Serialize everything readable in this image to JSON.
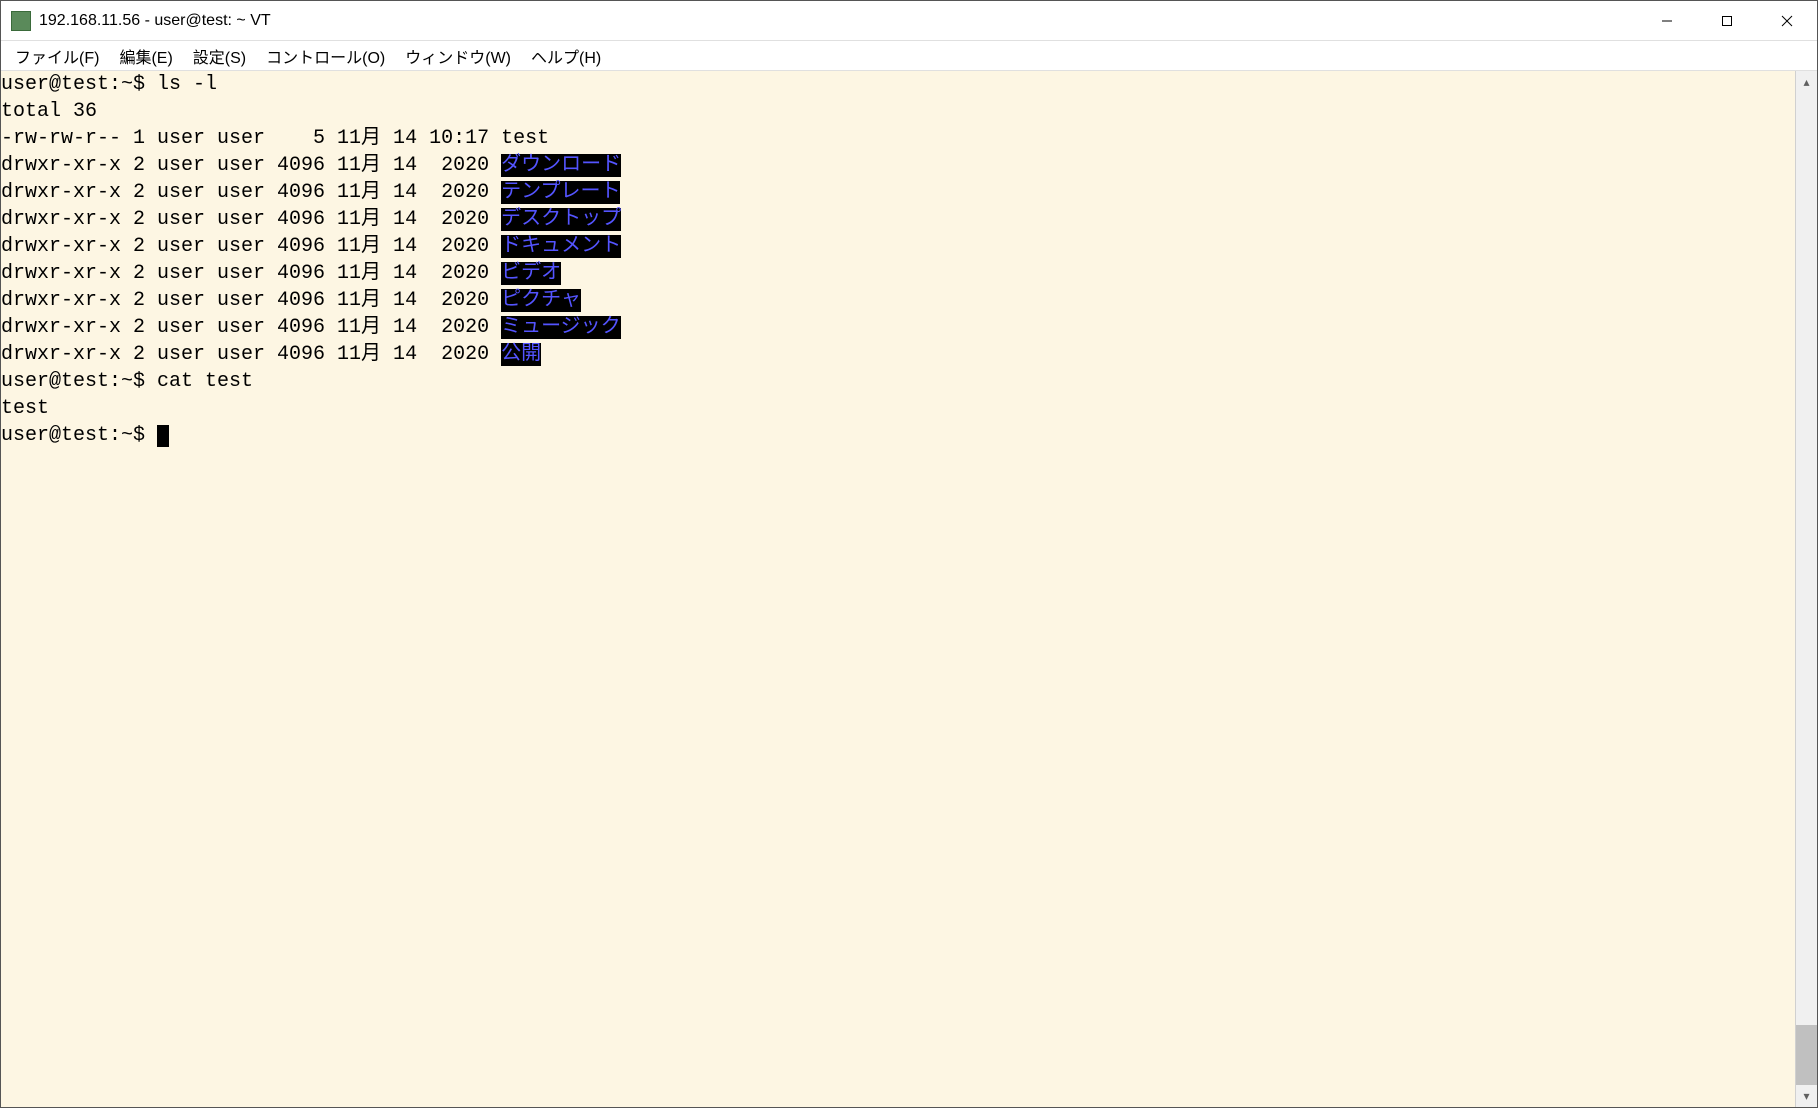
{
  "window": {
    "title": "192.168.11.56 - user@test: ~ VT"
  },
  "menubar": {
    "file": "ファイル(F)",
    "edit": "編集(E)",
    "setup": "設定(S)",
    "control": "コントロール(O)",
    "window": "ウィンドウ(W)",
    "help": "ヘルプ(H)"
  },
  "terminal": {
    "prompt1": "user@test:~$ ",
    "cmd1": "ls -l",
    "total_line": "total 36",
    "rows": [
      {
        "pre": "-rw-rw-r-- 1 user user    5 11月 14 10:17 ",
        "name": "test",
        "is_dir": false
      },
      {
        "pre": "drwxr-xr-x 2 user user 4096 11月 14  2020 ",
        "name": "ダウンロード",
        "is_dir": true
      },
      {
        "pre": "drwxr-xr-x 2 user user 4096 11月 14  2020 ",
        "name": "テンプレート",
        "is_dir": true
      },
      {
        "pre": "drwxr-xr-x 2 user user 4096 11月 14  2020 ",
        "name": "デスクトップ",
        "is_dir": true
      },
      {
        "pre": "drwxr-xr-x 2 user user 4096 11月 14  2020 ",
        "name": "ドキュメント",
        "is_dir": true
      },
      {
        "pre": "drwxr-xr-x 2 user user 4096 11月 14  2020 ",
        "name": "ビデオ",
        "is_dir": true
      },
      {
        "pre": "drwxr-xr-x 2 user user 4096 11月 14  2020 ",
        "name": "ピクチャ",
        "is_dir": true
      },
      {
        "pre": "drwxr-xr-x 2 user user 4096 11月 14  2020 ",
        "name": "ミュージック",
        "is_dir": true
      },
      {
        "pre": "drwxr-xr-x 2 user user 4096 11月 14  2020 ",
        "name": "公開",
        "is_dir": true
      }
    ],
    "prompt2": "user@test:~$ ",
    "cmd2": "cat test",
    "cat_output": "test",
    "prompt3": "user@test:~$ "
  }
}
